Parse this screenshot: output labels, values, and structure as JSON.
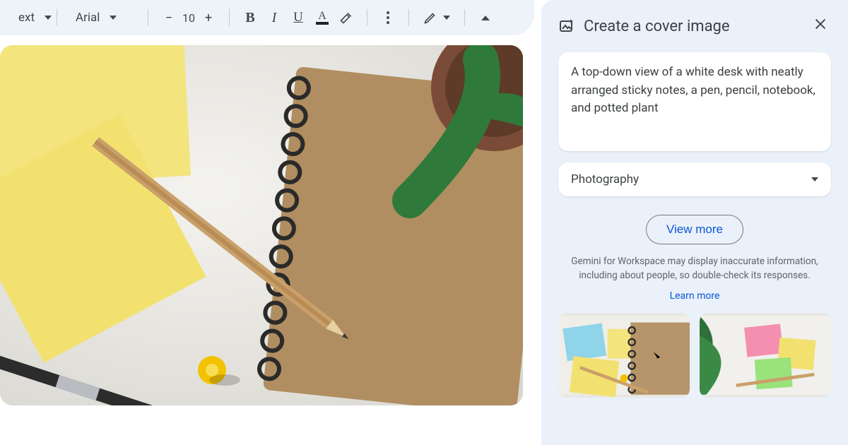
{
  "toolbar": {
    "style_label": "ext",
    "font_label": "Arial",
    "font_size": "10",
    "minus": "−",
    "plus": "+",
    "bold": "B",
    "italic": "I",
    "underline": "U",
    "color_letter": "A"
  },
  "panel": {
    "title": "Create a cover image",
    "prompt": "A top-down view of a white desk with neatly arranged sticky notes, a pen, pencil, notebook, and potted plant",
    "style_selected": "Photography",
    "view_more": "View more",
    "disclaimer": "Gemini for Workspace may display inaccurate information, including about people, so double-check its responses.",
    "learn_more": "Learn more"
  }
}
